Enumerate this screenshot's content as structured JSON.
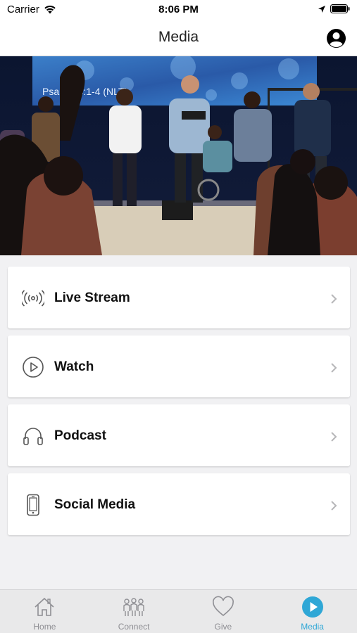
{
  "status_bar": {
    "carrier": "Carrier",
    "time": "8:06 PM"
  },
  "nav": {
    "title": "Media",
    "profile_icon": "person-circle-icon"
  },
  "hero": {
    "slide_text": "Psalm 84:1-4 (NLT)"
  },
  "menu": [
    {
      "label": "Live Stream",
      "icon": "broadcast-icon"
    },
    {
      "label": "Watch",
      "icon": "play-circle-icon"
    },
    {
      "label": "Podcast",
      "icon": "headphones-icon"
    },
    {
      "label": "Social Media",
      "icon": "phone-icon"
    }
  ],
  "tabs": [
    {
      "label": "Home",
      "icon": "home-icon",
      "active": false
    },
    {
      "label": "Connect",
      "icon": "people-icon",
      "active": false
    },
    {
      "label": "Give",
      "icon": "heart-icon",
      "active": false
    },
    {
      "label": "Media",
      "icon": "play-icon",
      "active": true
    }
  ],
  "colors": {
    "accent": "#2fa7d6",
    "tab_inactive": "#8e8e93",
    "background": "#f1f1f3"
  }
}
